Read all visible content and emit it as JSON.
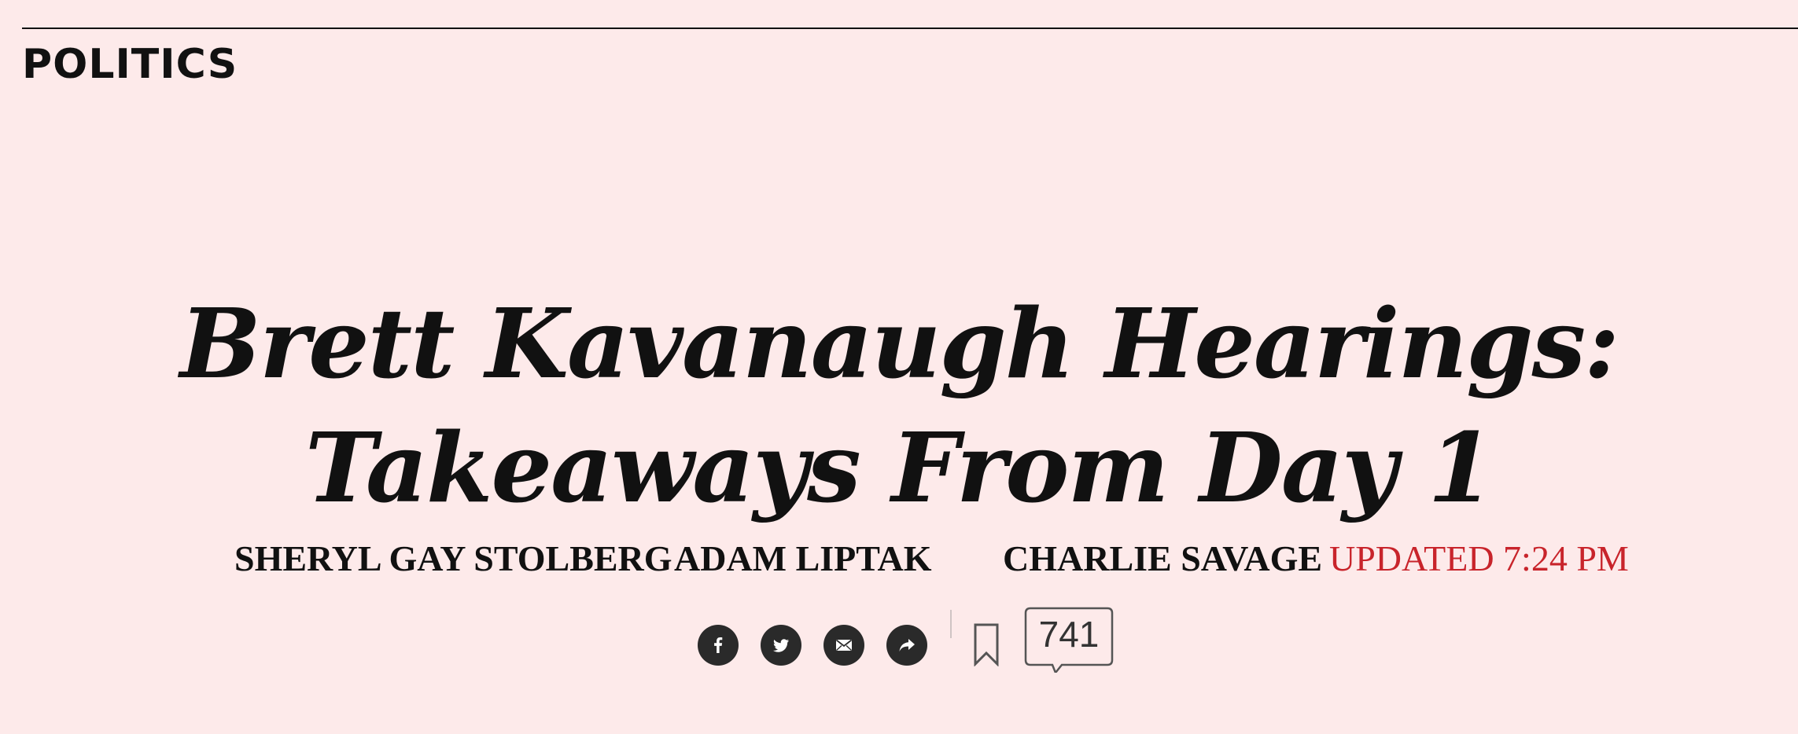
{
  "section": {
    "label": "POLITICS"
  },
  "headline": {
    "line1": "Brett Kavanaugh Hearings:",
    "line2": "Takeaways From Day 1"
  },
  "byline": {
    "authors": [
      "SHERYL GAY STOLBERG",
      "ADAM LIPTAK",
      "CHARLIE SAVAGE"
    ],
    "updated": "UPDATED 7:24 PM"
  },
  "share": {
    "buttons": [
      {
        "icon": "facebook-icon"
      },
      {
        "icon": "twitter-icon"
      },
      {
        "icon": "email-icon"
      },
      {
        "icon": "share-arrow-icon"
      }
    ],
    "save_icon": "bookmark-icon",
    "comment_count": "741"
  },
  "colors": {
    "background": "#fdeaea",
    "text": "#111111",
    "accent_red": "#c8242b",
    "icon_fill": "#2a2a2a"
  }
}
